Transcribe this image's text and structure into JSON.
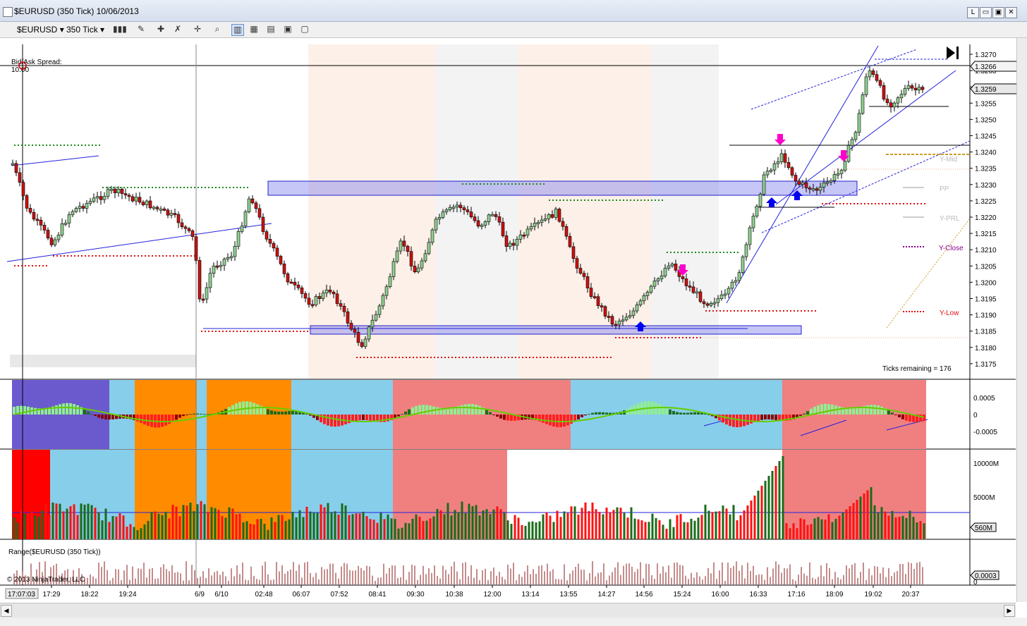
{
  "window": {
    "title": "$EURUSD (350 Tick)  10/06/2013",
    "buttons": [
      "L",
      "▭",
      "▣",
      "✕"
    ]
  },
  "toolbar": {
    "instrument": "$EURUSD",
    "interval": "350 Tick"
  },
  "price_axis": {
    "ticks": [
      "1.3270",
      "1.3265",
      "1.3260",
      "1.3255",
      "1.3250",
      "1.3245",
      "1.3240",
      "1.3235",
      "1.3230",
      "1.3225",
      "1.3220",
      "1.3215",
      "1.3210",
      "1.3205",
      "1.3200",
      "1.3195",
      "1.3190",
      "1.3185",
      "1.3180",
      "1.3175"
    ],
    "last_price": "1.3259",
    "marker_price": "1.3266"
  },
  "time_axis": {
    "current_time": "17:07:03",
    "labels": [
      "17:29",
      "18:22",
      "19:24",
      "6/9",
      "6/10",
      "02:48",
      "06:07",
      "07:52",
      "08:41",
      "09:30",
      "10:38",
      "12:00",
      "13:14",
      "13:55",
      "14:27",
      "14:56",
      "15:24",
      "16:00",
      "16:33",
      "17:16",
      "18:09",
      "19:02",
      "20:37"
    ]
  },
  "info": {
    "spread_label": "Bid/Ask Spread:",
    "spread_value": "10.00",
    "ticks_remaining": "Ticks remaining = 176",
    "copyright": "© 2013 NinjaTrader, LLC"
  },
  "pivots": {
    "y_mid": "Y-Mid",
    "pp": "PP",
    "y_prl": "Y-PRL",
    "y_close": "Y-Close",
    "y_low": "Y-Low"
  },
  "osc_axis": {
    "ticks": [
      "0.0005",
      "0",
      "-0.0005"
    ]
  },
  "volume_axis": {
    "ticks": [
      "10000M",
      "5000M"
    ],
    "current": "560M"
  },
  "range_panel": {
    "title": "Range($EURUSD (350 Tick))",
    "value": "0.0003",
    "zero": "0"
  },
  "colors": {
    "up": "#2e8b2e",
    "down": "#cc1111",
    "blue_zone": "#8080ee",
    "accent": "#0000cc"
  }
}
